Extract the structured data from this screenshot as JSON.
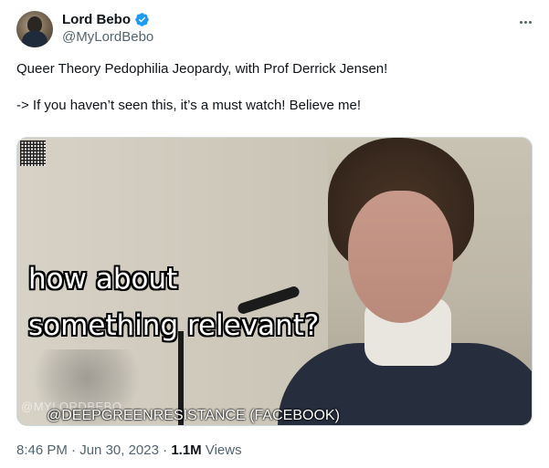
{
  "author": {
    "display_name": "Lord Bebo",
    "handle": "@MyLordBebo",
    "verified_color": "#1d9bf0"
  },
  "tweet": {
    "line1": "Queer Theory Pedophilia Jeopardy, with Prof Derrick Jensen!",
    "line2": "-> If you haven’t seen this, it’s a must watch! Believe me!"
  },
  "media": {
    "caption_line1": "how about",
    "caption_line2": "something relevant?",
    "watermark_handle": "@MYLORDBEBO",
    "watermark_source": "@DEEPGREENRESISTANCE (FACEBOOK)"
  },
  "meta": {
    "time": "8:46 PM",
    "separator1": " · ",
    "date": "Jun 30, 2023",
    "separator2": " · ",
    "views_count": "1.1M",
    "views_label": " Views"
  },
  "icons": {
    "more": "more-horizontal-icon",
    "verified": "verified-badge-icon"
  }
}
